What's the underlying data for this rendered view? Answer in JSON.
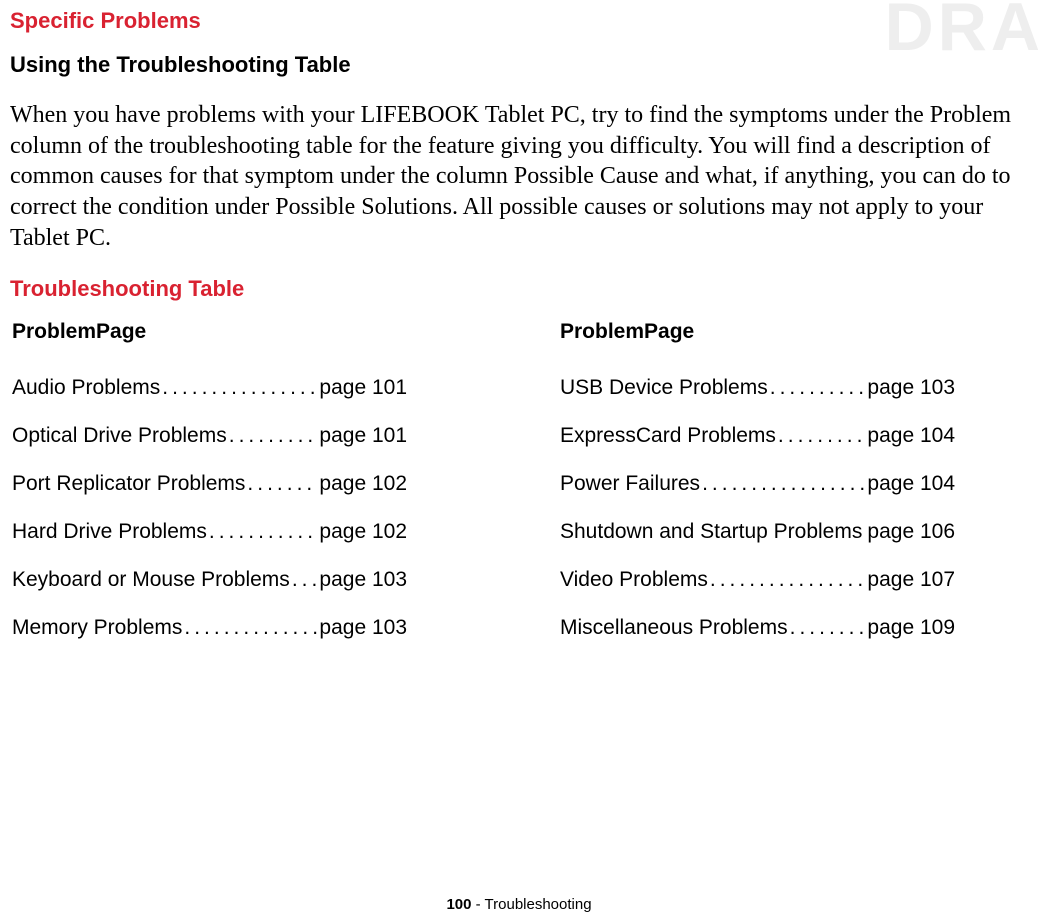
{
  "watermark": "DRA",
  "headings": {
    "section": "Specific Problems",
    "sub": "Using the Troubleshooting Table",
    "table": "Troubleshooting Table"
  },
  "paragraph": "When you have problems with your LIFEBOOK Tablet PC, try to find the symptoms under the Problem column of the troubleshooting table for the feature giving you difficulty. You will find a description of common causes for that symptom under the column Possible Cause and what, if anything, you can do to correct the condition under Possible Solutions. All possible causes or solutions may not apply to your Tablet PC.",
  "columns": {
    "left_header": "ProblemPage",
    "right_header": "ProblemPage"
  },
  "items_left": [
    {
      "label": "Audio Problems",
      "page": "page 101"
    },
    {
      "label": "Optical Drive Problems ",
      "page": "page 101"
    },
    {
      "label": "Port Replicator Problems",
      "page": "page 102"
    },
    {
      "label": "Hard Drive Problems",
      "page": "page 102"
    },
    {
      "label": "Keyboard or Mouse Problems",
      "page": "page 103"
    },
    {
      "label": "Memory Problems",
      "page": "page 103"
    }
  ],
  "items_right": [
    {
      "label": "USB Device Problems",
      "page": "page 103"
    },
    {
      "label": "ExpressCard Problems",
      "page": "page 104"
    },
    {
      "label": "Power Failures ",
      "page": "page 104"
    },
    {
      "label": "Shutdown and Startup Problems",
      "page": "page 106"
    },
    {
      "label": "Video Problems",
      "page": "page 107"
    },
    {
      "label": "Miscellaneous Problems",
      "page": "page 109"
    }
  ],
  "footer": {
    "page_number": "100",
    "sep": " - ",
    "section": "Troubleshooting"
  }
}
